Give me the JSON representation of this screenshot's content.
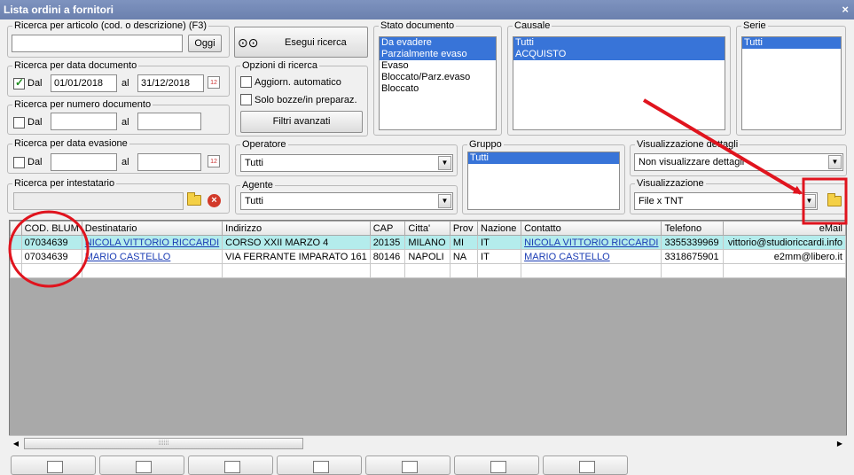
{
  "window": {
    "title": "Lista ordini a fornitori",
    "close": "×"
  },
  "search_article": {
    "label": "Ricerca per articolo (cod. o descrizione) (F3)",
    "value": "",
    "button": "Oggi"
  },
  "execute": {
    "label": "Esegui ricerca"
  },
  "search_date": {
    "label": "Ricerca per data documento",
    "check_label": "Dal",
    "checked": true,
    "from": "01/01/2018",
    "to_label": "al",
    "to": "31/12/2018"
  },
  "search_number": {
    "label": "Ricerca per numero documento",
    "check_label": "Dal",
    "from": "",
    "to_label": "al",
    "to": ""
  },
  "search_evasion": {
    "label": "Ricerca per data evasione",
    "check_label": "Dal",
    "from": "",
    "to_label": "al",
    "to": ""
  },
  "search_holder": {
    "label": "Ricerca per intestatario",
    "value": ""
  },
  "options": {
    "label": "Opzioni di ricerca",
    "auto_update": "Aggiorn. automatico",
    "drafts_only": "Solo bozze/in preparaz.",
    "advanced_filters": "Filtri avanzati"
  },
  "stato": {
    "label": "Stato documento",
    "items": [
      "Da evadere",
      "Parzialmente evaso",
      "Evaso",
      "Bloccato/Parz.evaso",
      "Bloccato"
    ]
  },
  "causale": {
    "label": "Causale",
    "items": [
      "Tutti",
      "ACQUISTO"
    ]
  },
  "serie": {
    "label": "Serie",
    "items": [
      "Tutti"
    ]
  },
  "operatore": {
    "label": "Operatore",
    "value": "Tutti"
  },
  "agente": {
    "label": "Agente",
    "value": "Tutti"
  },
  "gruppo": {
    "label": "Gruppo",
    "items": [
      "Tutti"
    ]
  },
  "vis_dettagli": {
    "label": "Visualizzazione dettagli",
    "value": "Non visualizzare dettagli"
  },
  "visualizzazione": {
    "label": "Visualizzazione",
    "value": "File x TNT"
  },
  "table": {
    "headers": [
      "COD. BLUM",
      "Destinatario",
      "Indirizzo",
      "CAP",
      "Citta'",
      "Prov",
      "Nazione",
      "Contatto",
      "Telefono",
      "eMail"
    ],
    "rows": [
      [
        "07034639",
        "NICOLA VITTORIO RICCARDI",
        "CORSO XXII MARZO 4",
        "20135",
        "MILANO",
        "MI",
        "IT",
        "NICOLA VITTORIO RICCARDI",
        "3355339969",
        "vittorio@studioriccardi.info"
      ],
      [
        "07034639",
        "MARIO CASTELLO",
        "VIA FERRANTE IMPARATO 161",
        "80146",
        "NAPOLI",
        "NA",
        "IT",
        "MARIO CASTELLO",
        "3318675901",
        "e2mm@libero.it"
      ]
    ]
  },
  "colors": {
    "title_bar": "#6b80ae",
    "selection": "#3874d8",
    "row_highlight": "#b4ecec",
    "annotation": "#e0141e"
  }
}
